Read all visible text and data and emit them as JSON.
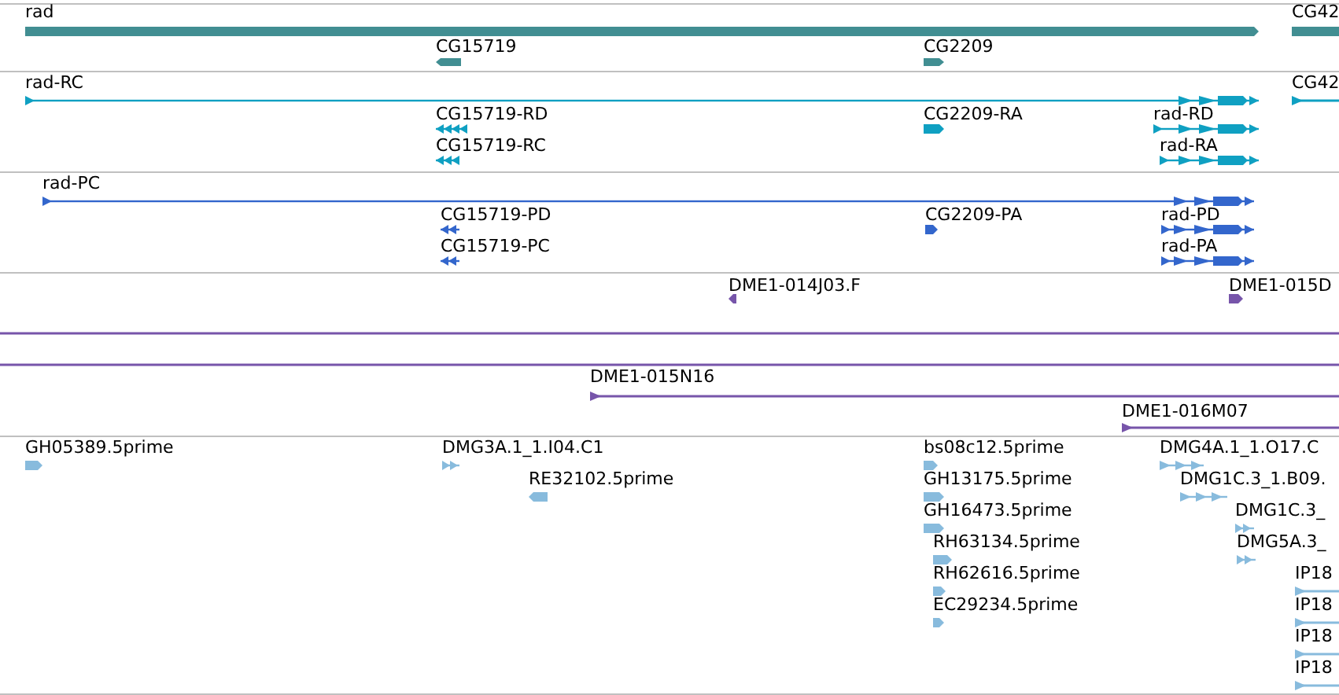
{
  "tracks": [
    {
      "color": "#418e92",
      "features": [
        {
          "label": "rad",
          "kind": "block",
          "reverse": false
        },
        {
          "label": "CG42",
          "kind": "bar"
        },
        {
          "label": "CG15719",
          "kind": "block",
          "reverse": true
        },
        {
          "label": "CG2209",
          "kind": "block",
          "reverse": false
        }
      ]
    },
    {
      "color": "#0fa0c2",
      "features": [
        {
          "label": "rad-RC",
          "kind": "exons",
          "reverse": false
        },
        {
          "label": "CG42",
          "kind": "line",
          "reverse": false
        },
        {
          "label": "CG15719-RD",
          "kind": "exons",
          "reverse": true
        },
        {
          "label": "CG2209-RA",
          "kind": "block",
          "reverse": false
        },
        {
          "label": "rad-RD",
          "kind": "exons",
          "reverse": false
        },
        {
          "label": "CG15719-RC",
          "kind": "exons",
          "reverse": true
        },
        {
          "label": "rad-RA",
          "kind": "exons",
          "reverse": false
        }
      ]
    },
    {
      "color": "#3366cc",
      "features": [
        {
          "label": "rad-PC",
          "kind": "exons",
          "reverse": false
        },
        {
          "label": "CG15719-PD",
          "kind": "exons",
          "reverse": true
        },
        {
          "label": "CG2209-PA",
          "kind": "block",
          "reverse": false
        },
        {
          "label": "rad-PD",
          "kind": "exons",
          "reverse": false
        },
        {
          "label": "CG15719-PC",
          "kind": "exons",
          "reverse": true
        },
        {
          "label": "rad-PA",
          "kind": "exons",
          "reverse": false
        }
      ]
    },
    {
      "color": "#7755aa",
      "features": [
        {
          "label": "DME1-014J03.F",
          "kind": "block",
          "reverse": true
        },
        {
          "label": "DME1-015D",
          "kind": "block",
          "reverse": false
        },
        {
          "kind": "span"
        },
        {
          "kind": "span"
        },
        {
          "label": "DME1-015N16",
          "kind": "line",
          "reverse": false
        },
        {
          "label": "DME1-016M07",
          "kind": "line",
          "reverse": false
        }
      ]
    },
    {
      "color": "#88bbdd",
      "features": [
        {
          "label": "GH05389.5prime",
          "kind": "block",
          "reverse": false
        },
        {
          "label": "DMG3A.1_1.I04.C1",
          "kind": "exons",
          "reverse": false
        },
        {
          "label": "bs08c12.5prime",
          "kind": "block",
          "reverse": false
        },
        {
          "label": "DMG4A.1_1.O17.C",
          "kind": "exons",
          "reverse": false
        },
        {
          "label": "RE32102.5prime",
          "kind": "block",
          "reverse": true
        },
        {
          "label": "GH13175.5prime",
          "kind": "block",
          "reverse": false
        },
        {
          "label": "DMG1C.3_1.B09.",
          "kind": "exons",
          "reverse": false
        },
        {
          "label": "GH16473.5prime",
          "kind": "block",
          "reverse": false
        },
        {
          "label": "DMG1C.3_",
          "kind": "exons",
          "reverse": false
        },
        {
          "label": "RH63134.5prime",
          "kind": "block",
          "reverse": false
        },
        {
          "label": "DMG5A.3_",
          "kind": "exons",
          "reverse": false
        },
        {
          "label": "RH62616.5prime",
          "kind": "block",
          "reverse": false
        },
        {
          "label": "IP18",
          "kind": "line",
          "reverse": false
        },
        {
          "label": "EC29234.5prime",
          "kind": "block",
          "reverse": false
        },
        {
          "label": "IP18",
          "kind": "line",
          "reverse": false
        },
        {
          "label": "IP18",
          "kind": "line",
          "reverse": false
        },
        {
          "label": "IP18",
          "kind": "line",
          "reverse": false
        }
      ]
    }
  ]
}
